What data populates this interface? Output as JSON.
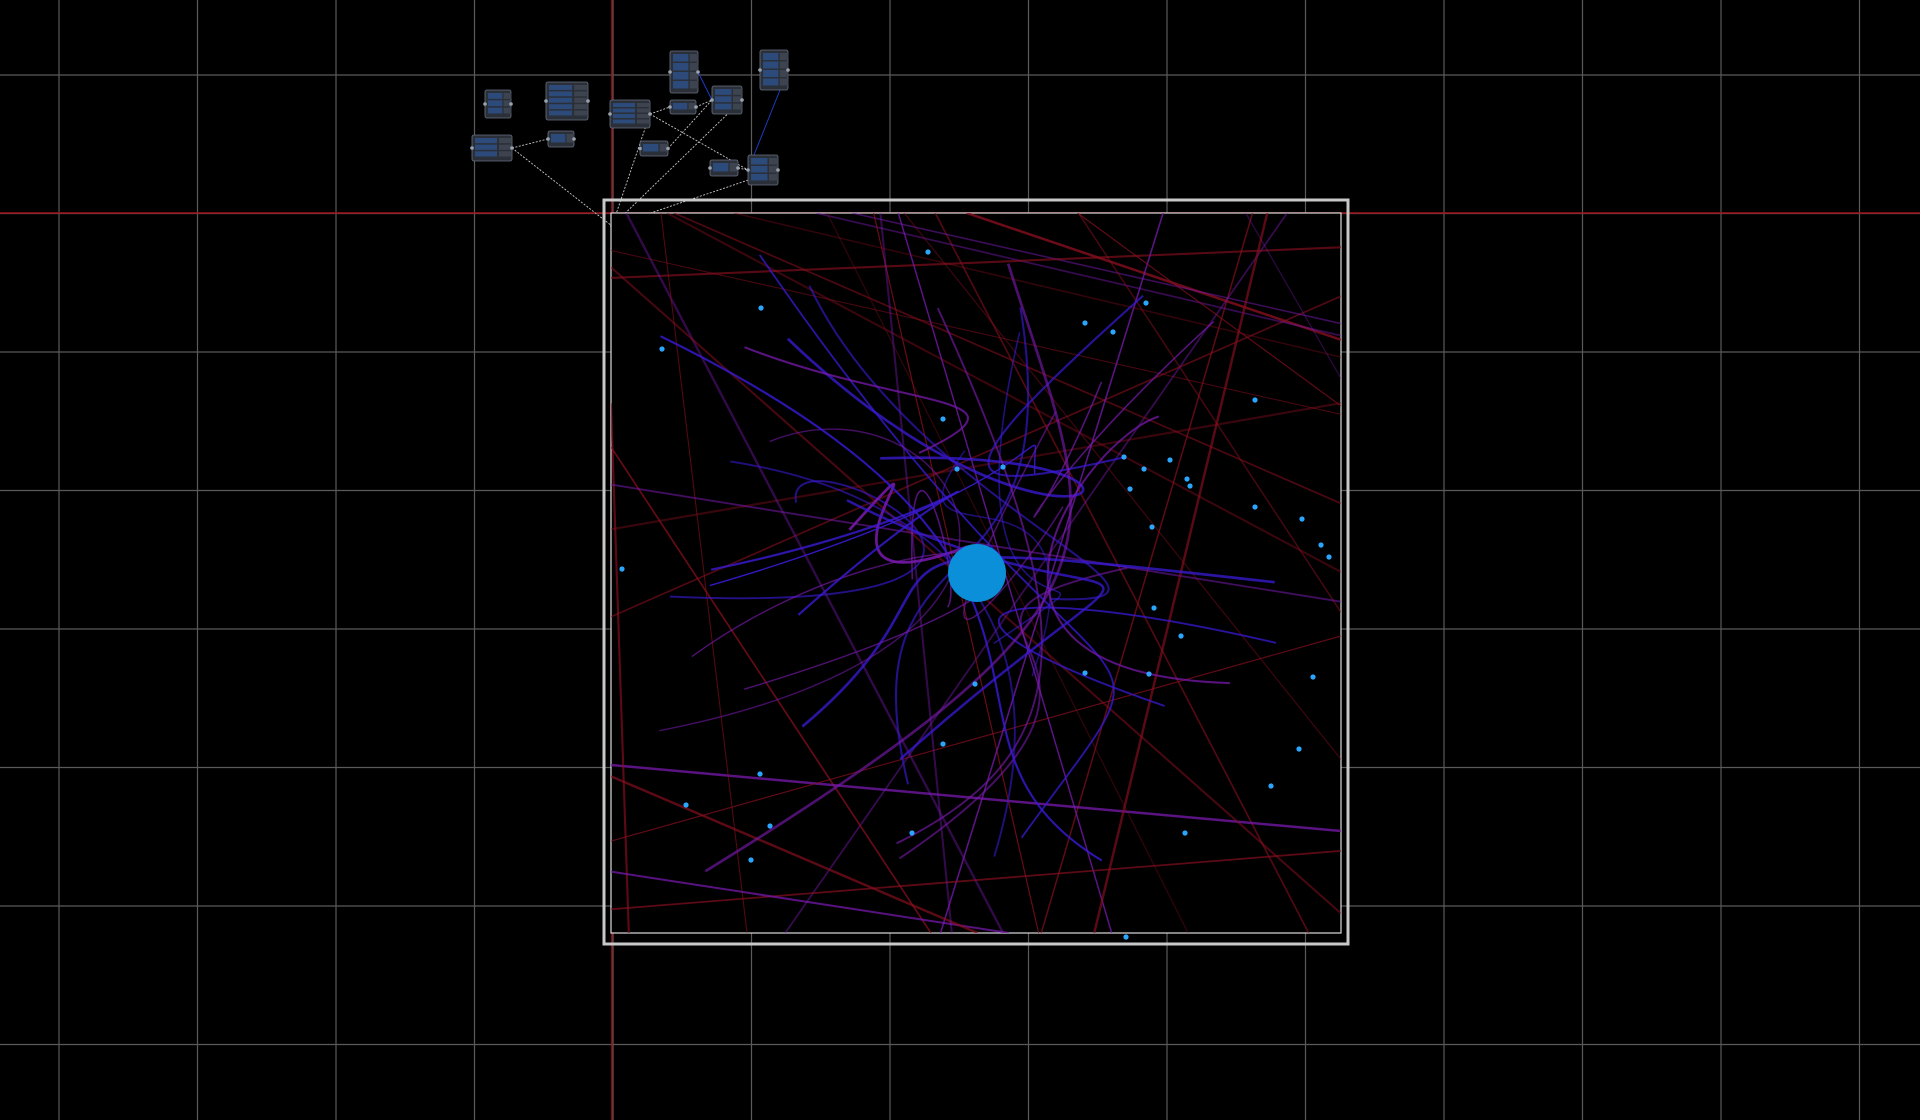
{
  "app": {
    "mode": "node-editor-canvas"
  },
  "colors": {
    "background": "#000000",
    "grid_line": "#5a5a5a",
    "axis_line": "#a0141e",
    "frame_outer": "#c8c8c8",
    "frame_inner": "#dcdcdc",
    "wire": "#c8c8c8",
    "wire_active": "#1e3fd0",
    "node_body": "#2a2f38",
    "node_panel": "#2c4a7a",
    "attractor": "#0a8fd8",
    "particle_head": "#2aa6ff",
    "trail_red": "#8a1020",
    "trail_blue": "#3a1ad6",
    "trail_violet": "#7a1ab0"
  },
  "icons": {
    "node": "operator-node-icon",
    "attractor": "attractor-circle-icon",
    "particle": "particle-dot-icon"
  },
  "viewport": {
    "grid": "on"
  },
  "scene": {
    "attractor_count": 1,
    "particle_count": 40,
    "node_count": 14
  }
}
